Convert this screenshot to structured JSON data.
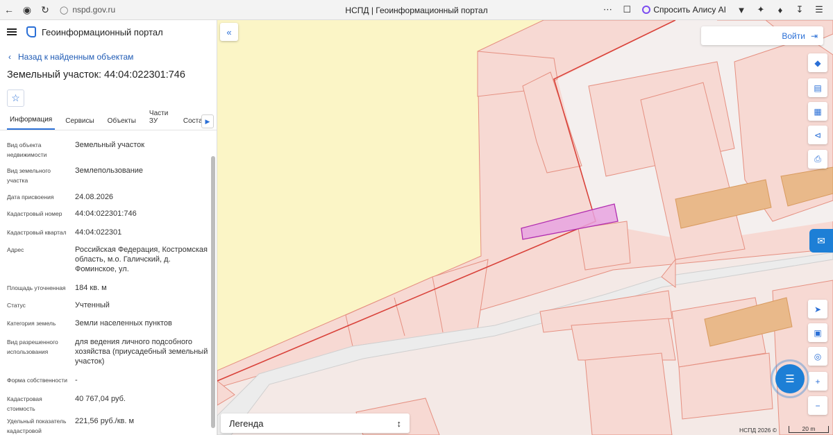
{
  "browser": {
    "url": "nspd.gov.ru",
    "tab_title": "НСПД | Геоинформационный портал",
    "alisa_label": "Спросить Алису AI"
  },
  "sidebar": {
    "portal_name": "Геоинформационный портал",
    "back_label": "Назад к найденным объектам",
    "object_title": "Земельный участок: 44:04:022301:746",
    "tabs": [
      "Информация",
      "Сервисы",
      "Объекты",
      "Части ЗУ",
      "Состав"
    ],
    "active_tab": "Информация",
    "properties": [
      {
        "label": "Вид объекта недвижимости",
        "value": "Земельный участок"
      },
      {
        "label": "Вид земельного участка",
        "value": "Землепользование"
      },
      {
        "label": "Дата присвоения",
        "value": "24.08.2026"
      },
      {
        "label": "Кадастровый номер",
        "value": "44:04:022301:746"
      },
      {
        "label": "Кадастровый квартал",
        "value": "44:04:022301"
      },
      {
        "label": "Адрес",
        "value": "Российская Федерация, Костромская область, м.о. Галичский, д. Фоминское, ул."
      },
      {
        "label": "Площадь уточненная",
        "value": "184 кв. м"
      },
      {
        "label": "Статус",
        "value": "Учтенный"
      },
      {
        "label": "Категория земель",
        "value": "Земли населенных пунктов"
      },
      {
        "label": "Вид разрешенного использования",
        "value": "для ведения личного подсобного хозяйства (приусадебный земельный участок)"
      },
      {
        "label": "Форма собственности",
        "value": "-"
      },
      {
        "label": "Кадастровая стоимость",
        "value": "40 767,04 руб."
      },
      {
        "label": "Удельный показатель кадастровой",
        "value": "221,56 руб./кв. м"
      }
    ]
  },
  "map": {
    "login_label": "Войти",
    "legend_label": "Легенда",
    "attribution": "НСПД 2026 ©",
    "scale_label": "20 m",
    "colors": {
      "parcel_fill": "#f7d9d3",
      "parcel_stroke": "#e58f80",
      "selected_fill": "#e7a3e0",
      "selected_stroke": "#b02cb0",
      "building_fill": "#e9b98a",
      "building_stroke": "#d89a5e",
      "land_fill": "#fbf5c6",
      "boundary": "#d9423a",
      "accent": "#1d7fd6"
    }
  }
}
